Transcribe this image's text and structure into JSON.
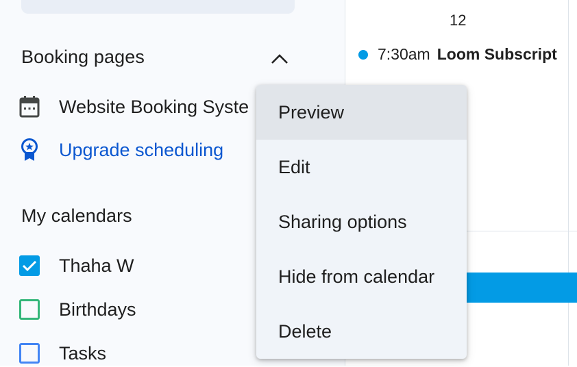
{
  "sidebar": {
    "booking_pages": {
      "title": "Booking pages",
      "items": [
        {
          "label": "Website Booking Syste",
          "icon": "calendar-icon"
        },
        {
          "label": "Upgrade scheduling",
          "icon": "award-ribbon-icon"
        }
      ]
    },
    "my_calendars": {
      "title": "My calendars",
      "items": [
        {
          "label": "Thaha W",
          "checked": true,
          "color": "#039be5"
        },
        {
          "label": "Birthdays",
          "checked": false,
          "color": "#33b679"
        },
        {
          "label": "Tasks",
          "checked": false,
          "color": "#4285f4"
        }
      ]
    }
  },
  "calendar": {
    "day_number": "12",
    "event": {
      "time": "7:30am",
      "title": "Loom Subscript",
      "color": "#039be5"
    }
  },
  "context_menu": {
    "items": [
      "Preview",
      "Edit",
      "Sharing options",
      "Hide from calendar",
      "Delete"
    ]
  },
  "colors": {
    "accent": "#0b57d0",
    "event_blue": "#039be5"
  }
}
